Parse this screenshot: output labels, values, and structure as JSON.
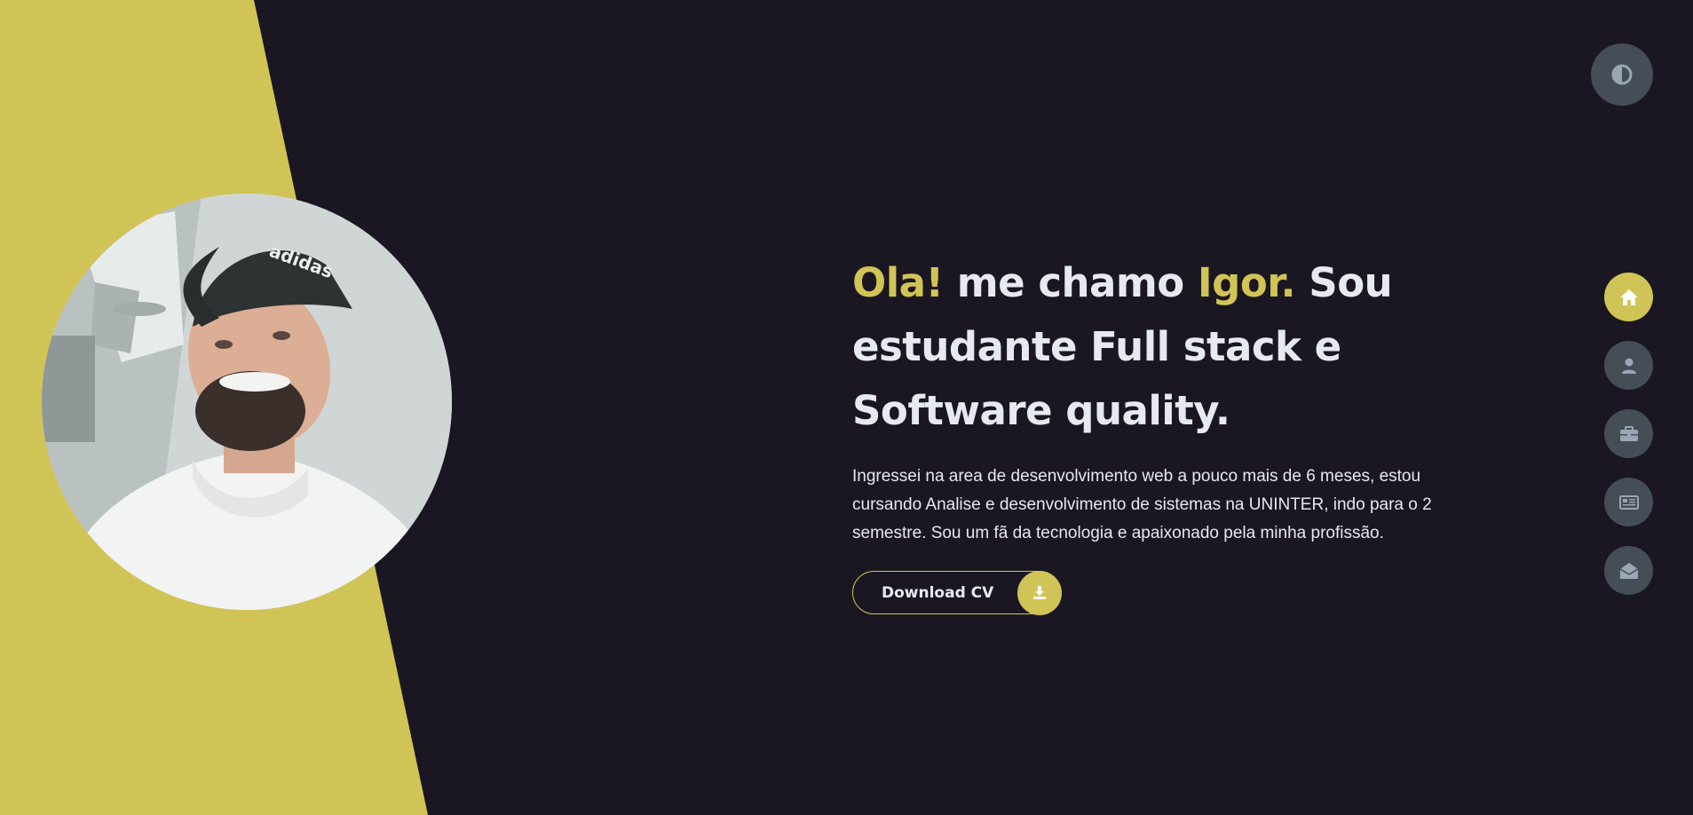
{
  "colors": {
    "accent": "#d1c456",
    "background": "#1b1722",
    "text": "#e6e9f1",
    "button_gray": "#454d56",
    "icon_gray": "#9aa6b6"
  },
  "theme_toggle": {
    "icon": "contrast-icon"
  },
  "nav": {
    "items": [
      {
        "icon": "home-icon",
        "active": true
      },
      {
        "icon": "user-icon",
        "active": false
      },
      {
        "icon": "briefcase-icon",
        "active": false
      },
      {
        "icon": "newspaper-icon",
        "active": false
      },
      {
        "icon": "envelope-open-icon",
        "active": false
      }
    ]
  },
  "hero": {
    "greeting": "Ola!",
    "name_prefix": " me chamo ",
    "name": "Igor.",
    "tagline": " Sou estudante Full stack e Software quality.",
    "intro": "Ingressei na area de desenvolvimento web a pouco mais de 6 meses, estou cursando Analise e desenvolvimento de sistemas na UNINTER, indo para o 2 semestre. Sou um fã da tecnologia e apaixonado pela minha profissão.",
    "cv_button": {
      "label": "Download CV",
      "icon": "download-icon"
    }
  },
  "profile_photo": {
    "cap_text": "adidas"
  }
}
